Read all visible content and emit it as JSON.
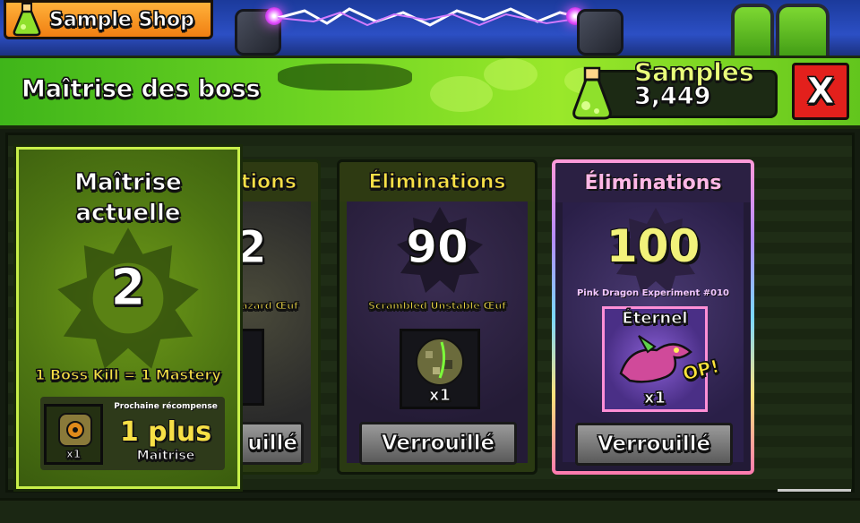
{
  "shop_button": {
    "label": "Sample Shop",
    "icon": "flask-icon"
  },
  "header": {
    "title": "Maîtrise des boss",
    "close_label": "X"
  },
  "samples": {
    "label": "Samples",
    "value": "3,449"
  },
  "mastery_card": {
    "title_line1": "Maîtrise",
    "title_line2": "actuelle",
    "level": "2",
    "rule": "1 Boss Kill = 1 Mastery",
    "next_reward_label": "Prochaine récompense",
    "reward_qty": "x1",
    "reward_amount": "1 plus",
    "reward_name": "Maîtrise"
  },
  "reward_cards": [
    {
      "header": "tions",
      "kills": "2",
      "reward_name": "azard Œuf",
      "button": "uillé"
    },
    {
      "header": "Éliminations",
      "kills": "90",
      "reward_name": "Scrambled Unstable Œuf",
      "qty": "x1",
      "button": "Verrouillé"
    },
    {
      "header": "Éliminations",
      "kills": "100",
      "reward_name": "Pink Dragon Experiment #010",
      "rarity": "Éternel",
      "badge": "OP!",
      "qty": "x1",
      "button": "Verrouillé"
    }
  ],
  "colors": {
    "accent_green": "#9ae82a",
    "close_red": "#e3201c",
    "gold": "#f7e046",
    "samples_yellow": "#eaff7a"
  }
}
